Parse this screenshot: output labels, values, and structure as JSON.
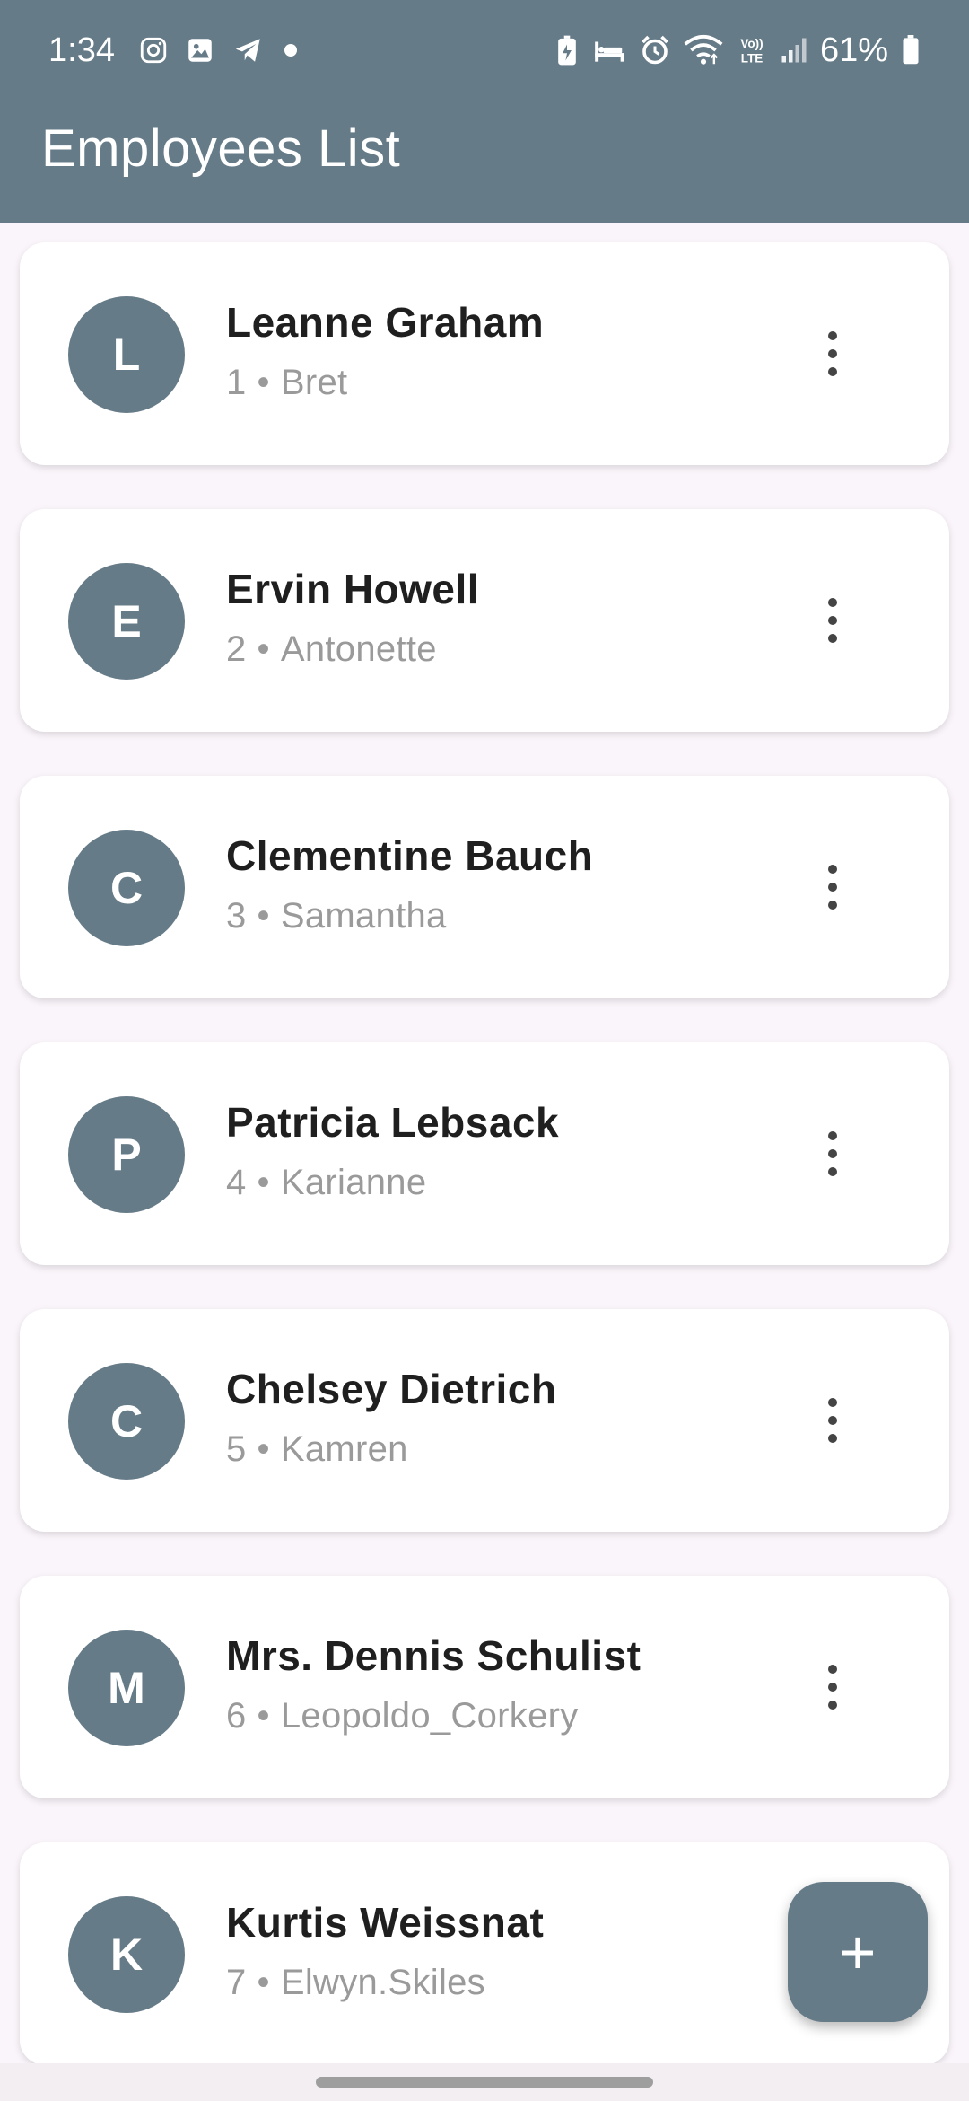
{
  "status_bar": {
    "time": "1:34",
    "battery": "61%",
    "left_icons": [
      "instagram-icon",
      "gallery-icon",
      "telegram-icon",
      "dot-icon"
    ],
    "right_icons": [
      "battery-saver-icon",
      "bed-icon",
      "alarm-icon",
      "wifi-icon",
      "volte-icon",
      "signal-icon",
      "battery-icon"
    ]
  },
  "app_bar": {
    "title": "Employees List"
  },
  "employees": [
    {
      "initial": "L",
      "name": "Leanne Graham",
      "id": "1",
      "username": "Bret"
    },
    {
      "initial": "E",
      "name": "Ervin Howell",
      "id": "2",
      "username": "Antonette"
    },
    {
      "initial": "C",
      "name": "Clementine Bauch",
      "id": "3",
      "username": "Samantha"
    },
    {
      "initial": "P",
      "name": "Patricia Lebsack",
      "id": "4",
      "username": "Karianne"
    },
    {
      "initial": "C",
      "name": "Chelsey Dietrich",
      "id": "5",
      "username": "Kamren"
    },
    {
      "initial": "M",
      "name": "Mrs. Dennis Schulist",
      "id": "6",
      "username": "Leopoldo_Corkery"
    },
    {
      "initial": "K",
      "name": "Kurtis Weissnat",
      "id": "7",
      "username": "Elwyn.Skiles"
    }
  ],
  "separator": "•",
  "fab": {
    "label": "+",
    "icon": "add-icon"
  },
  "colors": {
    "primary": "#667b88",
    "background": "#faf5fa",
    "card": "#ffffff"
  }
}
